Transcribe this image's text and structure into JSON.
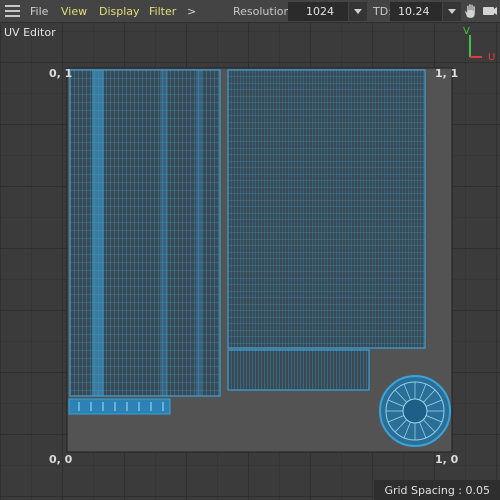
{
  "toolbar": {
    "menu_icon": "hamburger-menu-icon",
    "menus": [
      "File",
      "View",
      "Display",
      "Filter",
      ">"
    ],
    "resolution_label": "Resolution:",
    "resolution_value": "1024",
    "td_label": "TD:",
    "td_value": "10.24",
    "pan_icon": "hand-pan-icon"
  },
  "panel": {
    "title": "UV Editor"
  },
  "axis_gizmo": {
    "v_label": "V",
    "u_label": "U",
    "v_color": "#3ec23e",
    "u_color": "#e23b3b"
  },
  "corners": {
    "top_left": "0, 1",
    "top_right": "1, 1",
    "bottom_left": "0, 0",
    "bottom_right": "1, 0"
  },
  "status": {
    "grid_spacing": "Grid Spacing : 0.05"
  },
  "colors": {
    "uv_wire": "#3aa3d9",
    "uv_fill": "#226f99",
    "uv_space": "#535353",
    "grid": "#2d2d2d"
  }
}
